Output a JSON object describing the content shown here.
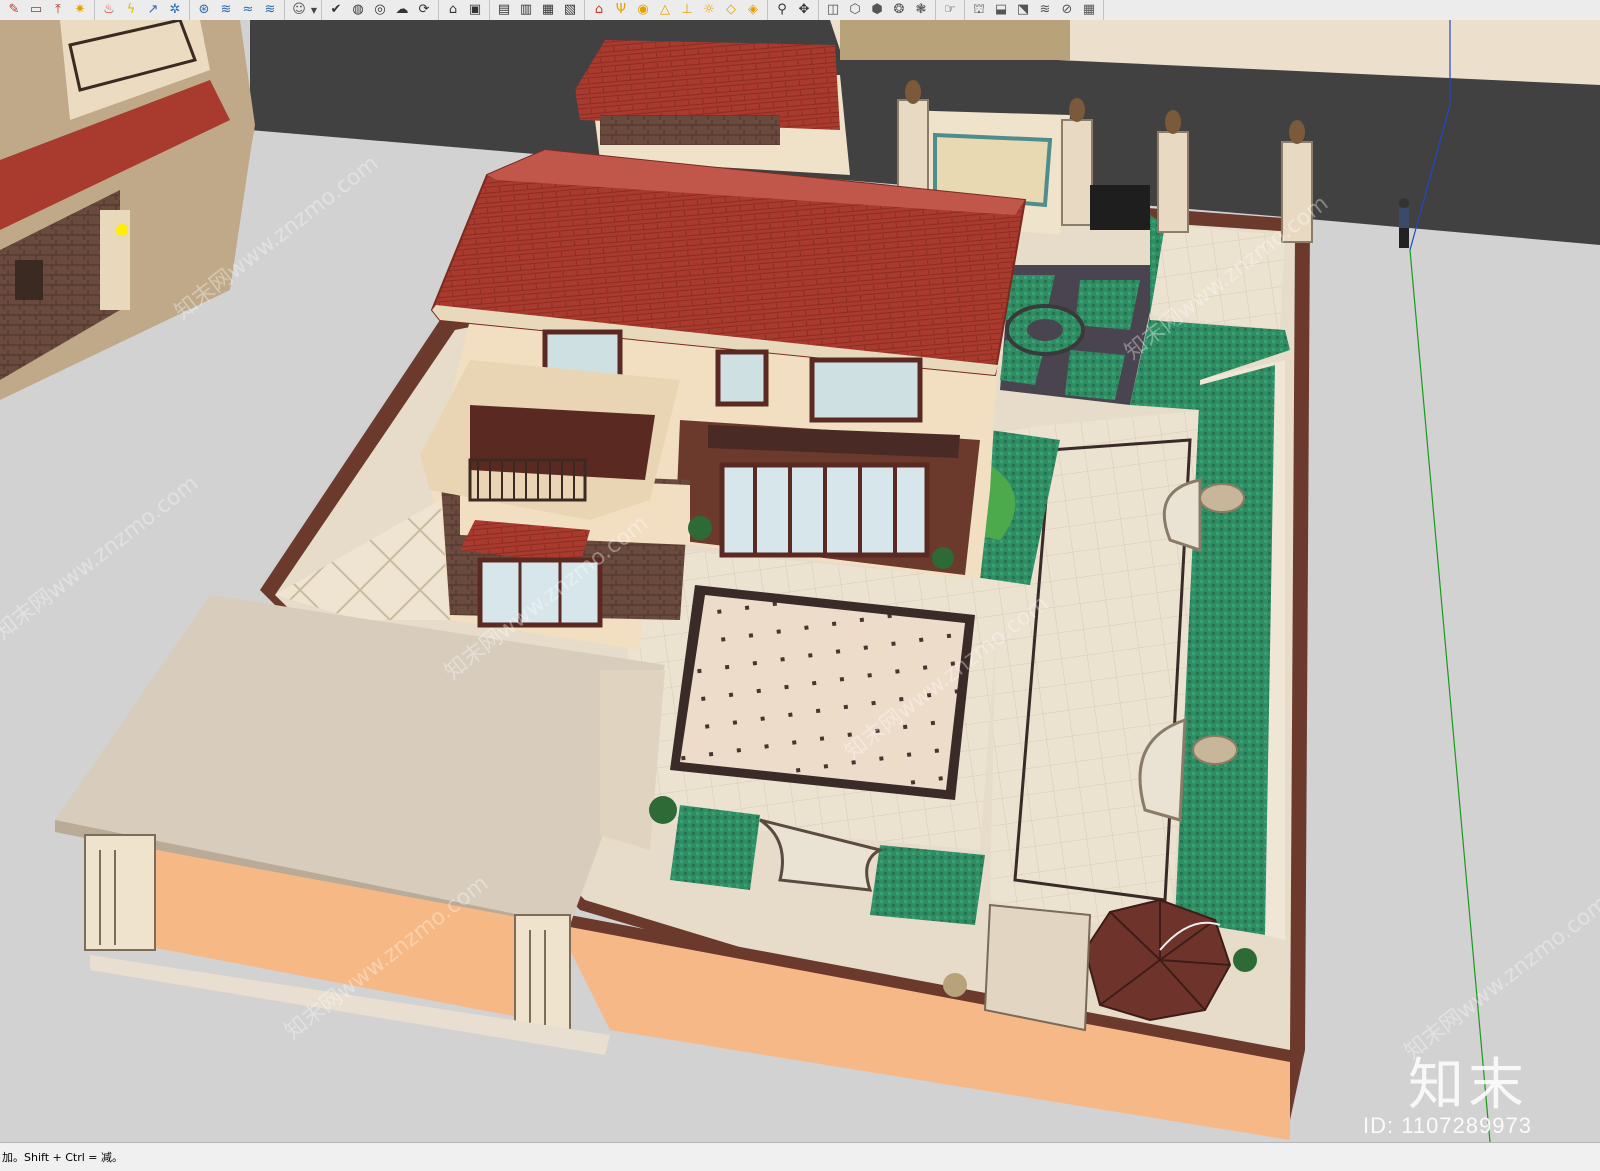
{
  "toolbar": {
    "groups": [
      {
        "name": "draw",
        "buttons": [
          {
            "name": "pencil-icon",
            "glyph": "✎",
            "color": "#c0392b"
          },
          {
            "name": "rectangle-icon",
            "glyph": "▭",
            "color": "#7a4a2a"
          },
          {
            "name": "pushpull-icon",
            "glyph": "⤒",
            "color": "#c0392b"
          },
          {
            "name": "flame-icon",
            "glyph": "✷",
            "color": "#e6a000"
          }
        ]
      },
      {
        "name": "modify",
        "buttons": [
          {
            "name": "paint-bucket-icon",
            "glyph": "♨",
            "color": "#d33"
          },
          {
            "name": "lightning-icon",
            "glyph": "ϟ",
            "color": "#e6b800"
          },
          {
            "name": "follow-me-icon",
            "glyph": "↗",
            "color": "#2a6ab0"
          },
          {
            "name": "star-icon",
            "glyph": "✲",
            "color": "#2a6ab0"
          }
        ]
      },
      {
        "name": "sandbox",
        "buttons": [
          {
            "name": "sandbox-contour-icon",
            "glyph": "⊛",
            "color": "#2a6ab0"
          },
          {
            "name": "sandbox-scratch-icon",
            "glyph": "≋",
            "color": "#2a6ab0"
          },
          {
            "name": "sandbox-smoove-icon",
            "glyph": "≈",
            "color": "#2a6ab0"
          },
          {
            "name": "sandbox-drape-icon",
            "glyph": "≋",
            "color": "#2a6ab0"
          }
        ]
      },
      {
        "name": "user",
        "buttons": [
          {
            "name": "user-icon",
            "glyph": "☺",
            "color": "#555"
          }
        ]
      },
      {
        "name": "solid",
        "buttons": [
          {
            "name": "check-icon",
            "glyph": "✔",
            "color": "#333"
          },
          {
            "name": "outer-shell-icon",
            "glyph": "◍",
            "color": "#333"
          },
          {
            "name": "intersect-icon",
            "glyph": "◎",
            "color": "#333"
          },
          {
            "name": "union-icon",
            "glyph": "☁",
            "color": "#333"
          },
          {
            "name": "subtract-icon",
            "glyph": "⟳",
            "color": "#333"
          }
        ]
      },
      {
        "name": "section",
        "buttons": [
          {
            "name": "section-plane-icon",
            "glyph": "⌂",
            "color": "#333"
          },
          {
            "name": "section-display-icon",
            "glyph": "▣",
            "color": "#333"
          }
        ]
      },
      {
        "name": "views",
        "buttons": [
          {
            "name": "view-front-icon",
            "glyph": "▤",
            "color": "#333"
          },
          {
            "name": "view-back-icon",
            "glyph": "▥",
            "color": "#333"
          },
          {
            "name": "view-left-icon",
            "glyph": "▦",
            "color": "#333"
          },
          {
            "name": "view-right-icon",
            "glyph": "▧",
            "color": "#333"
          }
        ]
      },
      {
        "name": "tools",
        "buttons": [
          {
            "name": "house-icon",
            "glyph": "⌂",
            "color": "#c0392b"
          },
          {
            "name": "tape-measure-icon",
            "glyph": "Ψ",
            "color": "#e6a000"
          },
          {
            "name": "protractor-icon",
            "glyph": "◉",
            "color": "#e6a000"
          },
          {
            "name": "triangle-icon",
            "glyph": "△",
            "color": "#e6a000"
          },
          {
            "name": "axes-icon",
            "glyph": "⊥",
            "color": "#e6a000"
          },
          {
            "name": "sun-icon",
            "glyph": "☼",
            "color": "#e6a000"
          },
          {
            "name": "dimension-icon",
            "glyph": "◇",
            "color": "#e6a000"
          },
          {
            "name": "component-icon",
            "glyph": "◈",
            "color": "#e6a000"
          }
        ]
      },
      {
        "name": "camera",
        "buttons": [
          {
            "name": "orbit-icon",
            "glyph": "⚲",
            "color": "#333"
          },
          {
            "name": "pan-icon",
            "glyph": "✥",
            "color": "#333"
          }
        ]
      },
      {
        "name": "styles",
        "buttons": [
          {
            "name": "xray-icon",
            "glyph": "◫",
            "color": "#555"
          },
          {
            "name": "wireframe-icon",
            "glyph": "⬡",
            "color": "#555"
          },
          {
            "name": "hidden-line-icon",
            "glyph": "⬢",
            "color": "#555"
          },
          {
            "name": "shaded-icon",
            "glyph": "❂",
            "color": "#555"
          },
          {
            "name": "shaded-textures-icon",
            "glyph": "❃",
            "color": "#555"
          }
        ]
      },
      {
        "name": "walk",
        "buttons": [
          {
            "name": "walk-hand-icon",
            "glyph": "☞",
            "color": "#333"
          }
        ]
      },
      {
        "name": "views-iso",
        "buttons": [
          {
            "name": "view-iso-icon",
            "glyph": "⛫",
            "color": "#555"
          },
          {
            "name": "view-top-icon",
            "glyph": "⬓",
            "color": "#555"
          },
          {
            "name": "view-cube-icon",
            "glyph": "⬔",
            "color": "#555"
          },
          {
            "name": "view-fog-icon",
            "glyph": "≋",
            "color": "#555"
          },
          {
            "name": "view-edge-icon",
            "glyph": "⊘",
            "color": "#555"
          },
          {
            "name": "view-grid-icon",
            "glyph": "▦",
            "color": "#555"
          }
        ]
      }
    ]
  },
  "status": {
    "text": "加。Shift + Ctrl = 减。"
  },
  "watermark": {
    "logo": "知末",
    "id": "ID: 1107289973",
    "tile_text": "知末网www.znzmo.com"
  },
  "colors": {
    "road": "#414141",
    "ground": "#d2d2d2",
    "roof": "#a83a2e",
    "wall_cream": "#f2dfc2",
    "wall_orange": "#f7b887",
    "paving": "#eae0cd",
    "lawn_green": "#2e8a5d",
    "timber": "#5a2a22",
    "axis_green": "#1a9a1a",
    "axis_blue": "#2048c8"
  }
}
